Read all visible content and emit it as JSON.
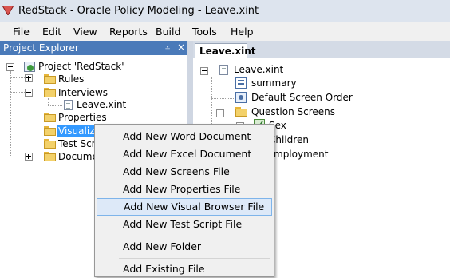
{
  "window": {
    "title": "RedStack - Oracle Policy Modeling - Leave.xint"
  },
  "menu": [
    "File",
    "Edit",
    "View",
    "Reports",
    "Build",
    "Tools",
    "Help"
  ],
  "project_explorer": {
    "title": "Project Explorer",
    "pin": "⩡",
    "close": "×",
    "root": "Project 'RedStack'",
    "items": [
      "Rules",
      "Interviews",
      "Leave.xint",
      "Properties",
      "Visualization",
      "Test Scrip",
      "Document"
    ]
  },
  "editor": {
    "tab": "Leave.xint",
    "root": "Leave.xint",
    "items": [
      "summary",
      "Default Screen Order",
      "Question Screens",
      "Sex",
      "Children",
      "mployment"
    ]
  },
  "context_menu": {
    "items": [
      "Add New Word Document",
      "Add New Excel Document",
      "Add New Screens File",
      "Add New Properties File",
      "Add New Visual Browser File",
      "Add New Test Script File",
      "Add New Folder",
      "Add Existing File"
    ],
    "highlighted": "Add New Visual Browser File"
  }
}
